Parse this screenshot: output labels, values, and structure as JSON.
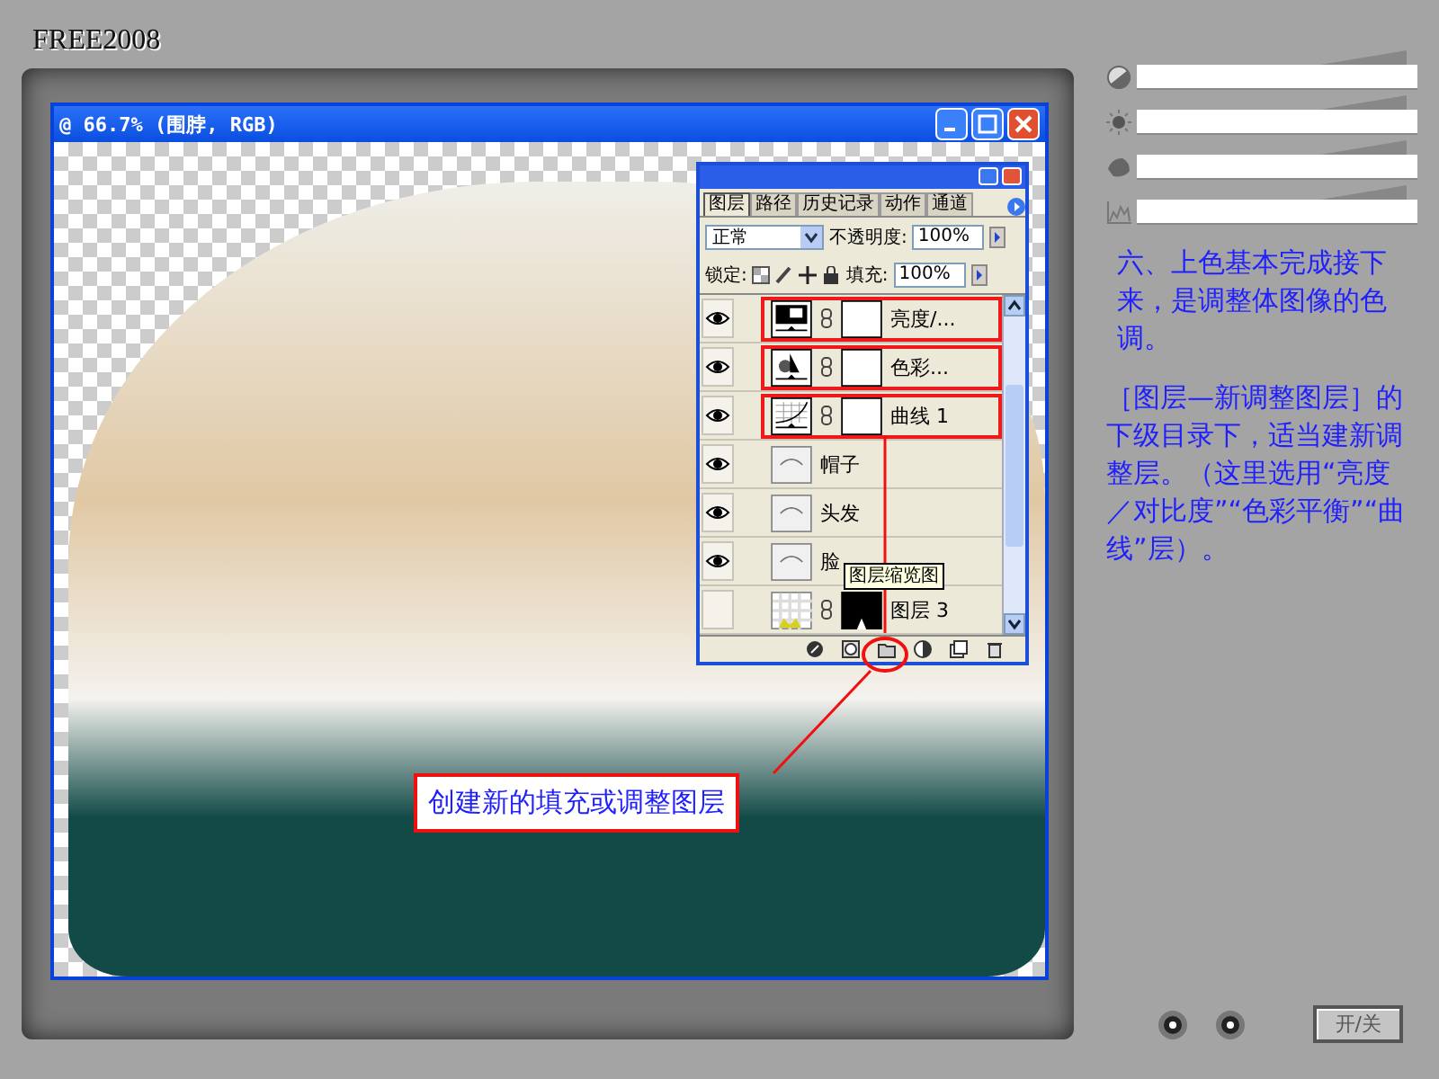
{
  "frame": {
    "logo": "FREE2008"
  },
  "document_window": {
    "title": "@ 66.7% (围脖, RGB)"
  },
  "layers_panel": {
    "tabs": [
      {
        "label": "图层",
        "selected": true
      },
      {
        "label": "路径",
        "selected": false
      },
      {
        "label": "历史记录",
        "selected": false
      },
      {
        "label": "动作",
        "selected": false
      },
      {
        "label": "通道",
        "selected": false
      }
    ],
    "blend_mode": "正常",
    "opacity_label": "不透明度:",
    "opacity": "100%",
    "lock_label": "锁定:",
    "fill_label": "填充:",
    "fill": "100%",
    "layers": [
      {
        "name": "亮度/...",
        "kind": "brightness",
        "visible": true,
        "highlighted": true
      },
      {
        "name": "色彩...",
        "kind": "color-balance",
        "visible": true,
        "highlighted": true
      },
      {
        "name": "曲线 1",
        "kind": "curves",
        "visible": true,
        "highlighted": true
      },
      {
        "name": "帽子",
        "kind": "pixel",
        "visible": true,
        "highlighted": false
      },
      {
        "name": "头发",
        "kind": "pixel",
        "visible": true,
        "highlighted": false
      },
      {
        "name": "脸",
        "kind": "pixel",
        "visible": true,
        "highlighted": false
      },
      {
        "name": "图层 3",
        "kind": "masked",
        "visible": false,
        "highlighted": false
      }
    ],
    "tooltip": "图层缩览图"
  },
  "callout": "创建新的填充或调整图层",
  "instructions": [
    "六、上色基本完成接下来，是调整体图像的色调。",
    "［图层—新调整图层］的下级目录下，适当建新调整层。（这里选用“亮度／对比度”“色彩平衡”“曲线”层）。"
  ],
  "power_button": "开/关"
}
